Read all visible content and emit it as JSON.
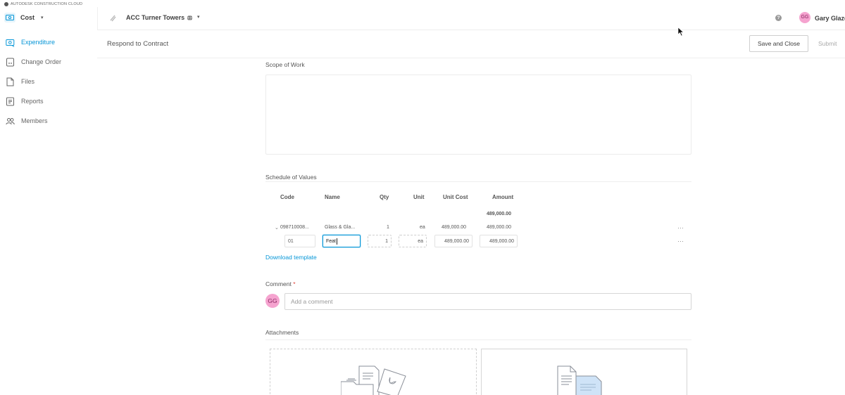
{
  "brand": {
    "text": "AUTODESK CONSTRUCTION CLOUD"
  },
  "module": {
    "label": "Cost",
    "icon": "cost-module-icon"
  },
  "nav": [
    {
      "label": "Expenditure",
      "icon": "expenditure-icon",
      "active": true
    },
    {
      "label": "Change Order",
      "icon": "change-order-icon",
      "active": false
    },
    {
      "label": "Files",
      "icon": "file-icon",
      "active": false
    },
    {
      "label": "Reports",
      "icon": "report-icon",
      "active": false
    },
    {
      "label": "Members",
      "icon": "members-icon",
      "active": false
    }
  ],
  "project": {
    "name": "ACC Turner Towers"
  },
  "user": {
    "initials": "GG",
    "name": "Gary Glaze"
  },
  "header": {
    "title": "Respond to Contract",
    "save_close_label": "Save and Close",
    "submit_label": "Submit"
  },
  "scope": {
    "title": "Scope of Work",
    "value": ""
  },
  "schedule": {
    "title": "Schedule of Values",
    "columns": [
      "Code",
      "Name",
      "Qty",
      "Unit",
      "Unit Cost",
      "Amount"
    ],
    "total": "489,000.00",
    "parent_row": {
      "code": "098710008...",
      "name": "Glass & Gla...",
      "qty": "1",
      "unit": "ea",
      "unit_cost": "489,000.00",
      "amount": "489,000.00"
    },
    "edit_row": {
      "code": "01",
      "name": "Feat",
      "qty": "1",
      "unit": "ea",
      "unit_cost": "489,000.00",
      "amount": "489,000.00"
    },
    "download_label": "Download template"
  },
  "comment": {
    "label": "Comment",
    "required_mark": "*",
    "initials": "GG",
    "placeholder": "Add a comment"
  },
  "attachments": {
    "title": "Attachments"
  },
  "colors": {
    "accent": "#0696d7",
    "avatar": "#f5a3cf",
    "required": "#e0483d"
  }
}
